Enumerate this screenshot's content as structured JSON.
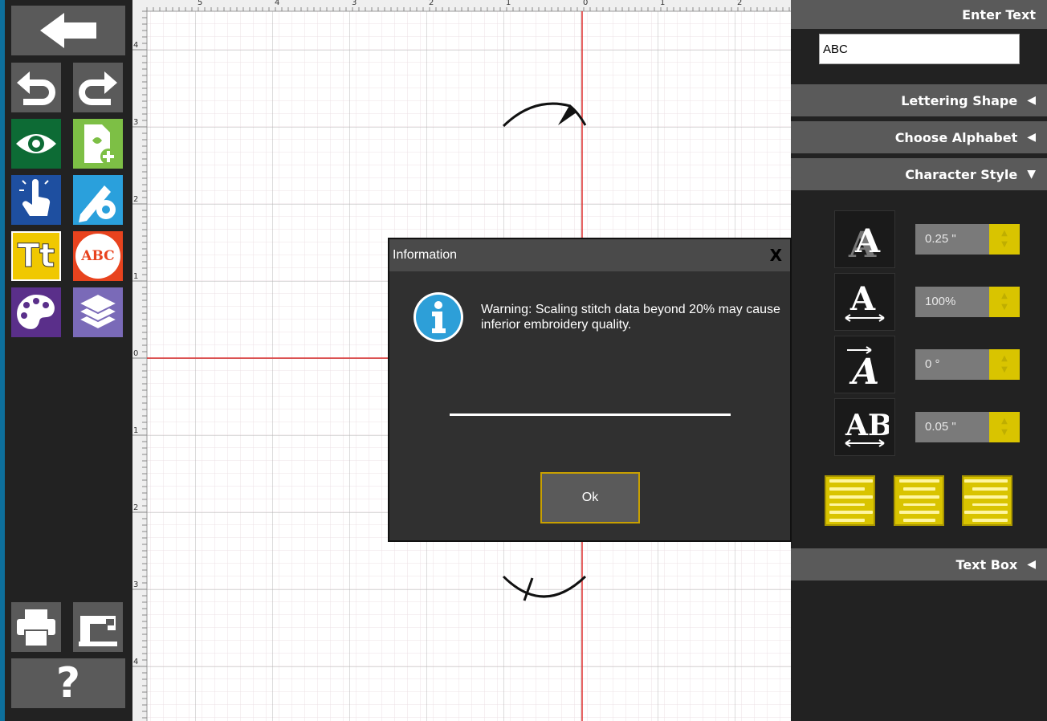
{
  "panel": {
    "enter_text_label": "Enter Text",
    "text_value": "ABC",
    "lettering_shape_label": "Lettering Shape",
    "choose_alphabet_label": "Choose Alphabet",
    "character_style_label": "Character Style",
    "text_box_label": "Text Box",
    "collapsed_icon": "◀",
    "expanded_icon": "▼",
    "styles": {
      "height": "0.25 \"",
      "width": "100%",
      "slant": "0 °",
      "spacing": "0.05 \""
    }
  },
  "toolbar": {
    "help_label": "?",
    "lettering_label": "Tt",
    "monogram_label": "ABC"
  },
  "ruler": {
    "top_labels": [
      "5",
      "4",
      "3",
      "2",
      "1",
      "0",
      "1",
      "2"
    ],
    "left_labels": [
      "4",
      "3",
      "2",
      "1",
      "0",
      "1",
      "2",
      "3",
      "4"
    ]
  },
  "dialog": {
    "title": "Information",
    "close_label": "X",
    "message": "Warning: Scaling stitch data beyond 20% may cause inferior embroidery quality.",
    "ok_label": "Ok"
  },
  "colors": {
    "accent_yellow": "#d9c400",
    "panel_header": "#5a5a5a",
    "axis_red": "#e03030",
    "info_blue": "#2d9fd8"
  }
}
